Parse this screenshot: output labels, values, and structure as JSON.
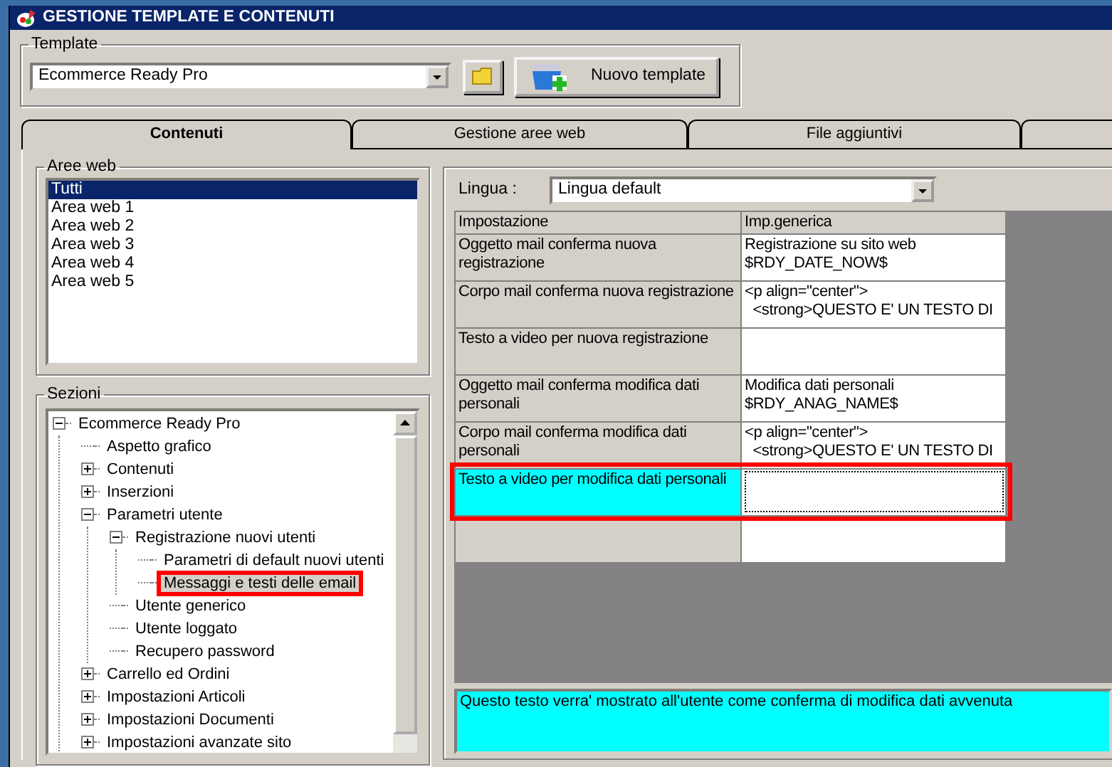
{
  "window": {
    "title": "GESTIONE TEMPLATE E CONTENUTI"
  },
  "template": {
    "label": "Template",
    "value": "Ecommerce Ready Pro",
    "new_button": "Nuovo template"
  },
  "tabs": [
    {
      "label": "Contenuti",
      "selected": true
    },
    {
      "label": "Gestione aree web",
      "selected": false
    },
    {
      "label": "File aggiuntivi",
      "selected": false
    },
    {
      "selected": false
    }
  ],
  "aree_web": {
    "label": "Aree web",
    "items": [
      {
        "label": "Tutti",
        "selected": true
      },
      {
        "label": "Area web 1",
        "selected": false
      },
      {
        "label": "Area web 2",
        "selected": false
      },
      {
        "label": "Area web 3",
        "selected": false
      },
      {
        "label": "Area web 4",
        "selected": false
      },
      {
        "label": "Area web 5",
        "selected": false
      }
    ]
  },
  "sezioni": {
    "label": "Sezioni",
    "tree": [
      {
        "label": "Ecommerce Ready Pro",
        "kind": "folder",
        "expanded": true,
        "selected": false,
        "highlighted": false,
        "children": [
          {
            "label": "Aspetto grafico",
            "kind": "leaf",
            "selected": false,
            "highlighted": false
          },
          {
            "label": "Contenuti",
            "kind": "folder",
            "expanded": false,
            "selected": false,
            "highlighted": false
          },
          {
            "label": "Inserzioni",
            "kind": "folder",
            "expanded": false,
            "selected": false,
            "highlighted": false
          },
          {
            "label": "Parametri utente",
            "kind": "folder",
            "expanded": true,
            "selected": false,
            "highlighted": false,
            "children": [
              {
                "label": "Registrazione nuovi utenti",
                "kind": "folder",
                "expanded": true,
                "selected": false,
                "highlighted": false,
                "children": [
                  {
                    "label": "Parametri di default nuovi utenti",
                    "kind": "leaf",
                    "selected": false,
                    "highlighted": false
                  },
                  {
                    "label": "Messaggi e testi delle email",
                    "kind": "leaf",
                    "selected": true,
                    "highlighted": true
                  }
                ]
              },
              {
                "label": "Utente generico",
                "kind": "leaf",
                "selected": false,
                "highlighted": false
              },
              {
                "label": "Utente loggato",
                "kind": "leaf",
                "selected": false,
                "highlighted": false
              },
              {
                "label": "Recupero password",
                "kind": "leaf",
                "selected": false,
                "highlighted": false
              }
            ]
          },
          {
            "label": "Carrello ed Ordini",
            "kind": "folder",
            "expanded": false,
            "selected": false,
            "highlighted": false
          },
          {
            "label": "Impostazioni Articoli",
            "kind": "folder",
            "expanded": false,
            "selected": false,
            "highlighted": false
          },
          {
            "label": "Impostazioni Documenti",
            "kind": "folder",
            "expanded": false,
            "selected": false,
            "highlighted": false
          },
          {
            "label": "Impostazioni avanzate sito",
            "kind": "folder",
            "expanded": false,
            "selected": false,
            "highlighted": false
          }
        ]
      }
    ]
  },
  "lingua": {
    "label": "Lingua :",
    "value": "Lingua default"
  },
  "grid": {
    "columns": [
      "Impostazione",
      "Imp.generica"
    ],
    "rows": [
      {
        "setting": "Oggetto mail conferma nuova registrazione",
        "value": "Registrazione su sito web\n$RDY_DATE_NOW$",
        "selected": false,
        "highlighted": false
      },
      {
        "setting": "Corpo mail conferma nuova registrazione",
        "value": "<p align=\"center\">\n  <strong>QUESTO E' UN TESTO DI",
        "selected": false,
        "highlighted": false
      },
      {
        "setting": "Testo a video per nuova registrazione",
        "selected": false,
        "highlighted": false
      },
      {
        "setting": "Oggetto mail conferma modifica dati personali",
        "value": "Modifica dati personali\n$RDY_ANAG_NAME$",
        "selected": false,
        "highlighted": false
      },
      {
        "setting": "Corpo mail conferma modifica dati personali",
        "value": "<p align=\"center\">\n  <strong>QUESTO E' UN TESTO DI",
        "selected": false,
        "highlighted": false
      },
      {
        "setting": "Testo a video per modifica dati personali",
        "selected": true,
        "highlighted": true
      }
    ]
  },
  "description": {
    "text": "Questo testo verra' mostrato all'utente come conferma di modifica dati avvenuta"
  }
}
